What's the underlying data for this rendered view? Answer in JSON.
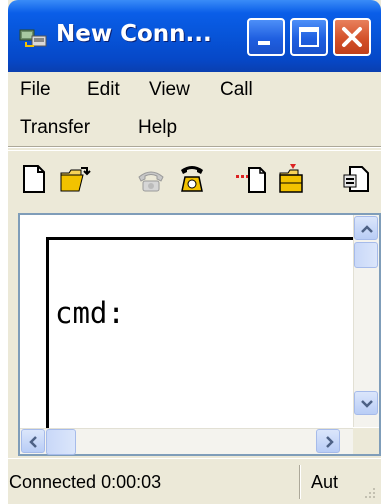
{
  "window": {
    "title": "New Conn...",
    "controls": {
      "minimize_icon": "minimize-icon",
      "maximize_icon": "maximize-icon",
      "close_icon": "close-icon"
    }
  },
  "menubar": {
    "items": [
      "File",
      "Edit",
      "View",
      "Call",
      "Transfer",
      "Help"
    ]
  },
  "toolbar": {
    "tools": [
      {
        "icon": "new-document-icon"
      },
      {
        "icon": "open-folder-icon"
      },
      {
        "icon": "connect-phone-icon",
        "disabled": true
      },
      {
        "icon": "disconnect-phone-icon"
      },
      {
        "icon": "send-file-icon"
      },
      {
        "icon": "receive-file-icon"
      },
      {
        "icon": "properties-icon"
      }
    ]
  },
  "terminal": {
    "text": "cmd:"
  },
  "statusbar": {
    "connection": "Connected 0:00:03",
    "mode": "Aut"
  },
  "colors": {
    "titlebar": "#0754d8",
    "close_button": "#d4512a",
    "chrome": "#ece9d8",
    "terminal_bg": "#ffffff"
  }
}
